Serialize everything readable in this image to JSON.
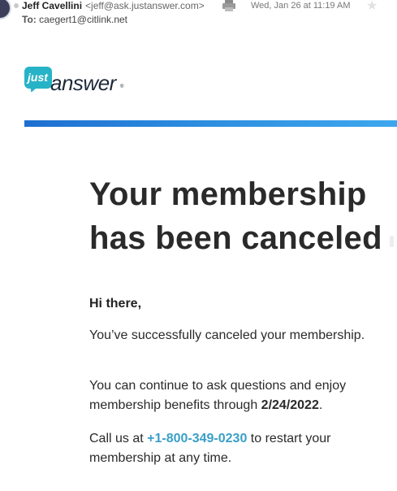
{
  "email": {
    "sender_name": "Jeff Cavellini",
    "sender_address": "<jeff@ask.justanswer.com>",
    "to_label": "To:",
    "to_address": "caegert1@citlink.net",
    "date": "Wed, Jan 26 at 11:19 AM"
  },
  "logo": {
    "just": "just",
    "answer": "answer",
    "tm": "®"
  },
  "content": {
    "headline_line1": "Your membership",
    "headline_line2": "has been canceled",
    "greeting": "Hi there,",
    "p1": "You’ve successfully canceled your membership.",
    "p2_text": "You can continue to ask questions and enjoy membership benefits through ",
    "p2_date": "2/24/2022",
    "p2_end": ".",
    "p3_start": "Call us at ",
    "p3_phone": "+1-800-349-0230",
    "p3_end": " to restart your membership at any time."
  },
  "colors": {
    "brand_teal": "#27b3c7",
    "bar_blue": "#2e8fe0",
    "link": "#3a9fc7"
  }
}
